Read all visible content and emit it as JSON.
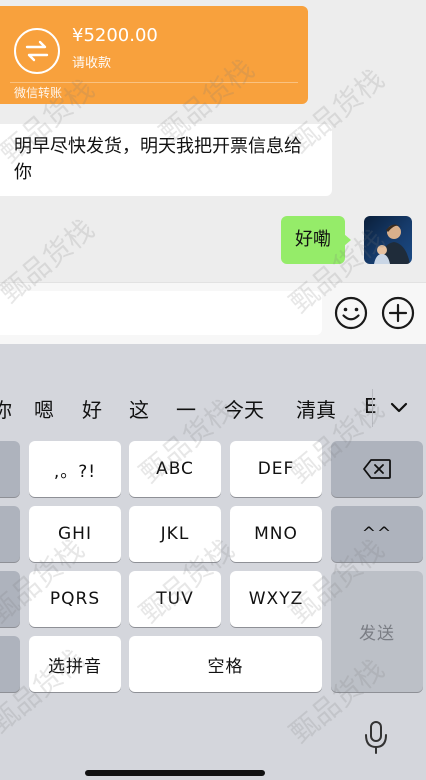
{
  "transfer": {
    "amount": "¥5200.00",
    "status": "请收款",
    "footer": "微信转账",
    "color": "#f8a13d"
  },
  "messages": {
    "incoming": "明早尽快发货，明天我把开票信息给你",
    "outgoing": "好嘞"
  },
  "input_bar": {
    "emoji_icon": "emoji-smile-icon",
    "plus_icon": "plus-circle-icon"
  },
  "keyboard": {
    "candidates": [
      "你",
      "嗯",
      "好",
      "这",
      "一",
      "今天",
      "清真",
      "E"
    ],
    "rows": [
      [
        ",。?!",
        "ABC",
        "DEF"
      ],
      [
        "GHI",
        "JKL",
        "MNO"
      ],
      [
        "PQRS",
        "TUV",
        "WXYZ"
      ]
    ],
    "pinyin": "选拼音",
    "space": "空格",
    "emoticon": "^^",
    "send": "发送"
  },
  "watermark": "甄品货栈",
  "colors": {
    "bubble_out": "#95ec69",
    "keyboard_bg": "#d4d6dc"
  }
}
